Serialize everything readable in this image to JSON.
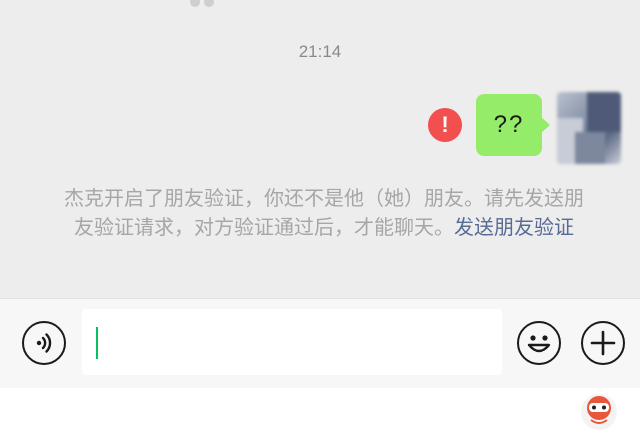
{
  "chat": {
    "timestamp": "21:14",
    "sent_message": "??",
    "error_icon_glyph": "!",
    "system_message": {
      "text": "杰克开启了朋友验证，你还不是他（她）朋友。请先发送朋友验证请求，对方验证通过后，才能聊天。",
      "link_text": "发送朋友验证"
    }
  },
  "input_bar": {
    "text_value": "",
    "icons": {
      "voice": "voice-icon",
      "emoji": "emoji-icon",
      "more": "plus-icon"
    }
  },
  "colors": {
    "bubble": "#95ec69",
    "error": "#f24f4f",
    "link": "#576b95",
    "caret": "#07c160"
  }
}
